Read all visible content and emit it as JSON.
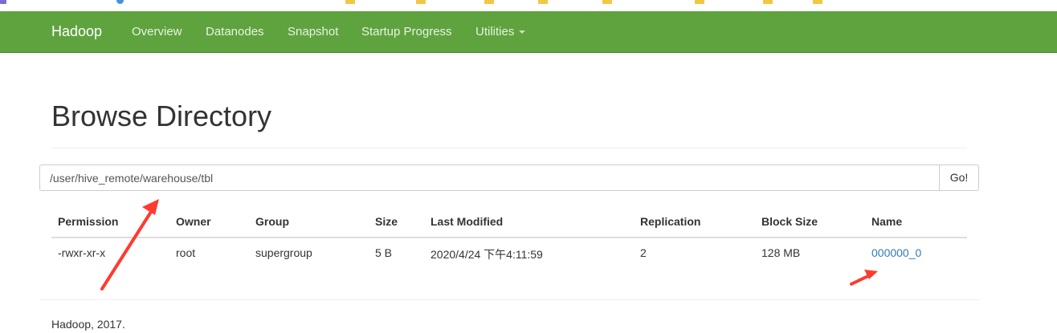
{
  "navbar": {
    "brand": "Hadoop",
    "items": [
      "Overview",
      "Datanodes",
      "Snapshot",
      "Startup Progress",
      "Utilities"
    ],
    "color": "#5fa33e"
  },
  "page": {
    "title": "Browse Directory"
  },
  "directory": {
    "path": "/user/hive_remote/warehouse/tbl",
    "go_label": "Go!"
  },
  "table": {
    "headers": [
      "Permission",
      "Owner",
      "Group",
      "Size",
      "Last Modified",
      "Replication",
      "Block Size",
      "Name"
    ],
    "rows": [
      [
        "-rwxr-xr-x",
        "root",
        "supergroup",
        "5 B",
        "2020/4/24 下午4:11:59",
        "2",
        "128 MB",
        "000000_0"
      ]
    ]
  },
  "footer": {
    "text": "Hadoop, 2017."
  },
  "annotation": {
    "arrow_color": "#ff3b2f"
  }
}
